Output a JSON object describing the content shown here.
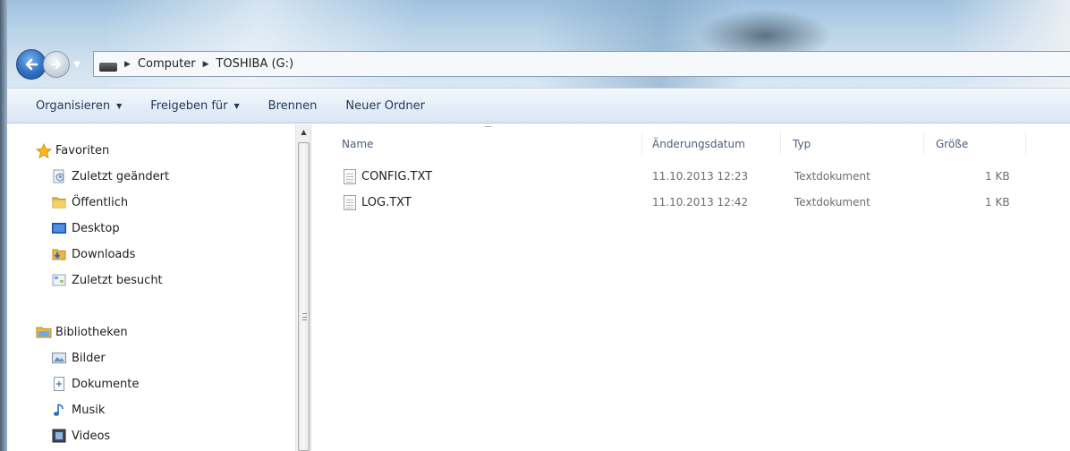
{
  "window": {
    "address_path": [
      "Computer",
      "TOSHIBA (G:)"
    ]
  },
  "toolbar": {
    "organize": "Organisieren",
    "share": "Freigeben für",
    "burn": "Brennen",
    "new_folder": "Neuer Ordner"
  },
  "navpane": {
    "favorites": {
      "header": "Favoriten",
      "items": [
        {
          "label": "Zuletzt geändert",
          "icon": "recent-changes-icon"
        },
        {
          "label": "Öffentlich",
          "icon": "folder-icon"
        },
        {
          "label": "Desktop",
          "icon": "desktop-icon"
        },
        {
          "label": "Downloads",
          "icon": "downloads-folder-icon"
        },
        {
          "label": "Zuletzt besucht",
          "icon": "recent-places-icon"
        }
      ]
    },
    "libraries": {
      "header": "Bibliotheken",
      "items": [
        {
          "label": "Bilder",
          "icon": "pictures-icon"
        },
        {
          "label": "Dokumente",
          "icon": "documents-icon"
        },
        {
          "label": "Musik",
          "icon": "music-icon"
        },
        {
          "label": "Videos",
          "icon": "videos-icon"
        }
      ]
    }
  },
  "filelist": {
    "columns": {
      "name": "Name",
      "modified": "Änderungsdatum",
      "type": "Typ",
      "size": "Größe"
    },
    "files": [
      {
        "name": "CONFIG.TXT",
        "modified": "11.10.2013 12:23",
        "type": "Textdokument",
        "size": "1 KB"
      },
      {
        "name": "LOG.TXT",
        "modified": "11.10.2013 12:42",
        "type": "Textdokument",
        "size": "1 KB"
      }
    ]
  },
  "colors": {
    "toolbar_text": "#1e3957",
    "header_text": "#4c607a",
    "glass": "#b9d3e8"
  }
}
